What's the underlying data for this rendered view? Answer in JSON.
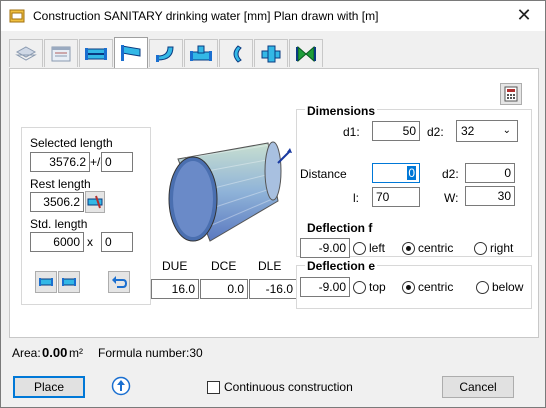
{
  "window": {
    "title": "Construction SANITARY drinking water [mm]    Plan drawn with  [m]",
    "close_glyph": "✕"
  },
  "tabs": [
    {
      "icon": "tab-layers-icon",
      "active": false
    },
    {
      "icon": "tab-table-icon",
      "active": false
    },
    {
      "icon": "tab-pipe-straight-icon",
      "active": false
    },
    {
      "icon": "tab-reducer-icon",
      "active": true
    },
    {
      "icon": "tab-bend-icon",
      "active": false
    },
    {
      "icon": "tab-tee-icon",
      "active": false
    },
    {
      "icon": "tab-arc-icon",
      "active": false
    },
    {
      "icon": "tab-cross-icon",
      "active": false
    },
    {
      "icon": "tab-valve-icon",
      "active": false
    }
  ],
  "length_group": {
    "selected_length_label": "Selected length",
    "selected_length_value": "3576.2",
    "plus_minus_label": "+/-",
    "plus_minus_value": "0",
    "rest_length_label": "Rest length",
    "rest_length_value": "3506.2",
    "std_length_label": "Std. length",
    "std_length_value": "6000",
    "times_label": "x",
    "times_value": "0"
  },
  "offsets": {
    "due_label": "DUE",
    "due_value": "16.0",
    "dce_label": "DCE",
    "dce_value": "0.0",
    "dle_label": "DLE",
    "dle_value": "-16.0"
  },
  "dimensions": {
    "title": "Dimensions",
    "d1_label": "d1:",
    "d1_value": "50",
    "d2_label": "d2:",
    "d2_value": "32",
    "distance_label": "Distance",
    "distance_value": "0",
    "d2b_label": "d2:",
    "d2b_value": "0",
    "l_label": "l:",
    "l_value": "70",
    "w_label": "W:",
    "w_value": "30"
  },
  "deflection_f": {
    "title": "Deflection f",
    "value": "-9.00",
    "options": [
      "left",
      "centric",
      "right"
    ],
    "selected": 1
  },
  "deflection_e": {
    "title": "Deflection e",
    "value": "-9.00",
    "options": [
      "top",
      "centric",
      "below"
    ],
    "selected": 1
  },
  "status": {
    "area_label": "Area:",
    "area_value": "0.00",
    "area_unit": "m²",
    "formula_label": "Formula number:30"
  },
  "footer": {
    "place_label": "Place",
    "continuous_label": "Continuous construction",
    "cancel_label": "Cancel"
  },
  "colors": {
    "accent": "#0078d7",
    "icon_blue": "#1a6fd0",
    "icon_cyan": "#33b8e6",
    "icon_green": "#1e9e3a",
    "cone_body": "#8fb3d8",
    "cone_dark": "#4a6fb0"
  }
}
